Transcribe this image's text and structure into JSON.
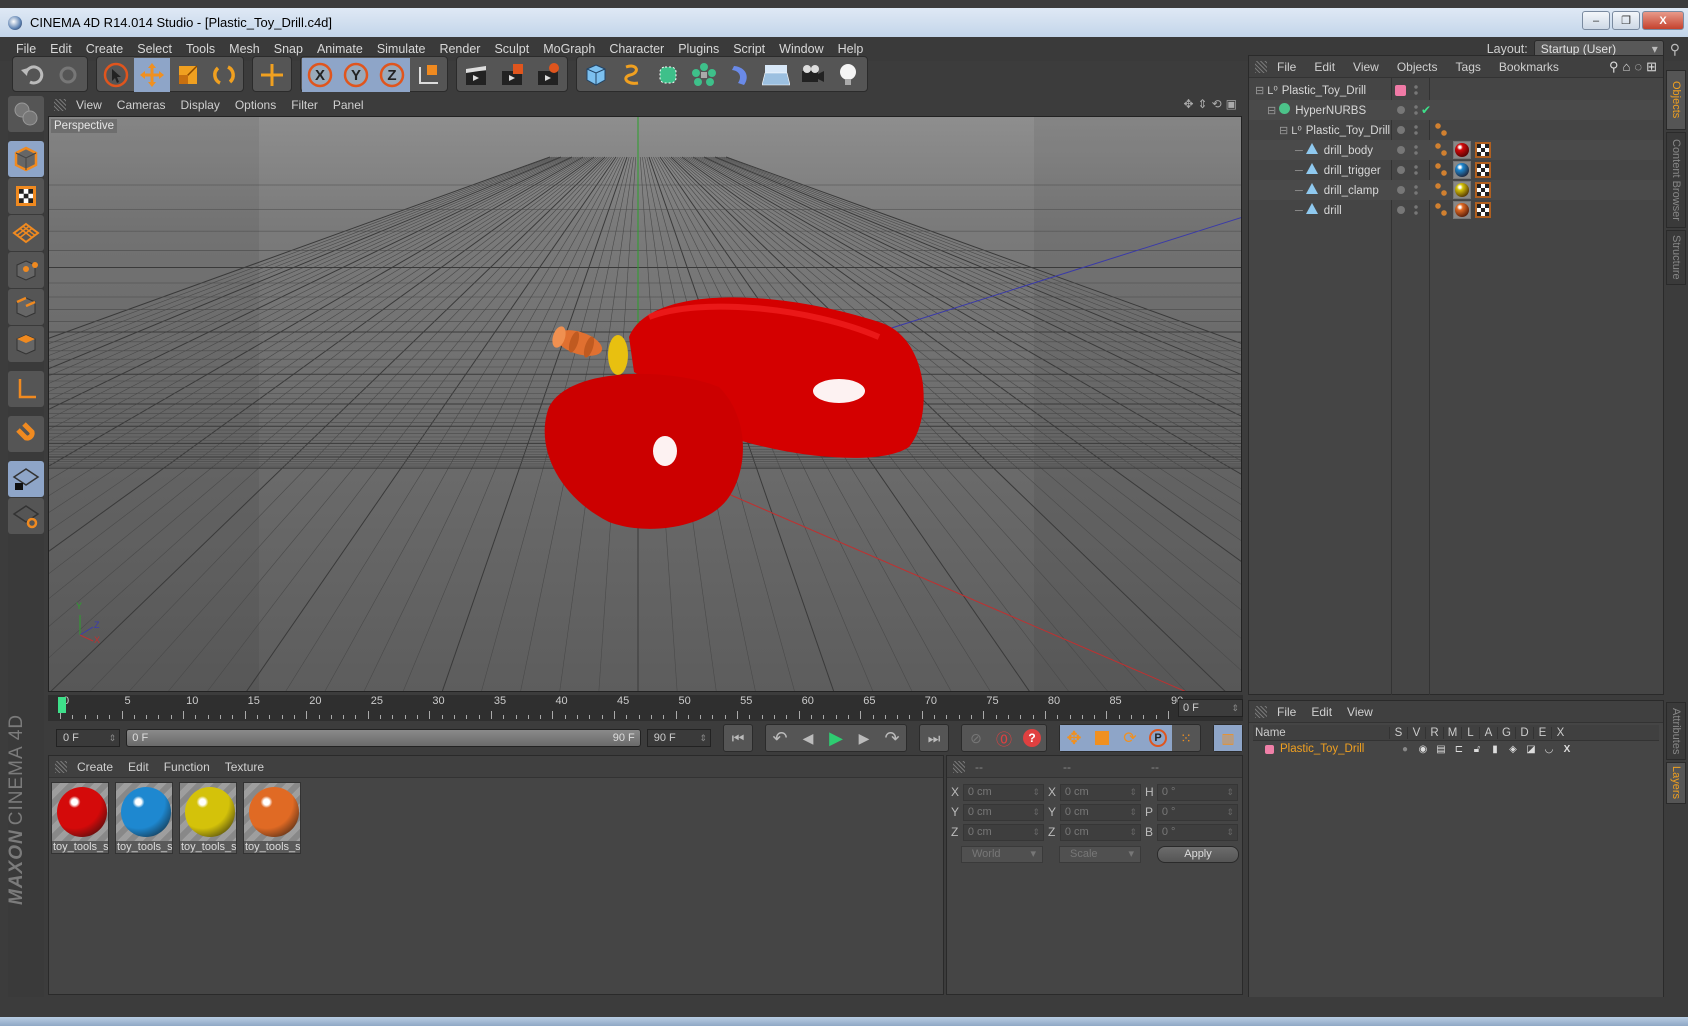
{
  "window": {
    "title": "CINEMA 4D R14.014 Studio - [Plastic_Toy_Drill.c4d]",
    "controls": {
      "minimize": "–",
      "restore": "❐",
      "close": "X"
    }
  },
  "menu": [
    "File",
    "Edit",
    "Create",
    "Select",
    "Tools",
    "Mesh",
    "Snap",
    "Animate",
    "Simulate",
    "Render",
    "Sculpt",
    "MoGraph",
    "Character",
    "Plugins",
    "Script",
    "Window",
    "Help"
  ],
  "layout": {
    "label": "Layout:",
    "value": "Startup (User)"
  },
  "toolbar": {
    "groups": [
      [
        "undo-icon",
        "redo-icon"
      ],
      [
        "live-selection-icon",
        "move-icon",
        "scale-icon",
        "rotate-icon"
      ],
      [
        "recent-tool-icon"
      ],
      [
        "x-axis-lock-icon",
        "y-axis-lock-icon",
        "z-axis-lock-icon",
        "world-coordinates-icon"
      ],
      [
        "render-view-icon",
        "render-picture-viewer-icon",
        "render-settings-icon"
      ],
      [
        "cube-object-icon",
        "spline-pen-icon",
        "subdivision-surface-icon",
        "cloner-icon",
        "deformer-icon",
        "floor-icon",
        "camera-icon",
        "light-icon"
      ]
    ]
  },
  "left_palette": [
    "camera-view-icon",
    "model-mode-icon",
    "texture-mode-icon",
    "workplane-mode-icon",
    "points-mode-icon",
    "edges-mode-icon",
    "polygons-mode-icon",
    "axis-mode-icon",
    "snap-magnet-icon",
    "workplane-lock-icon",
    "workplane-rotate-icon"
  ],
  "branding": {
    "maxon": "MAXON",
    "product": "CINEMA 4D"
  },
  "viewport": {
    "menu": [
      "View",
      "Cameras",
      "Display",
      "Options",
      "Filter",
      "Panel"
    ],
    "camera_label": "Perspective",
    "axis_labels": {
      "y": "Y",
      "z": "Z",
      "x": "X"
    }
  },
  "timeline": {
    "ticks": [
      "0",
      "5",
      "10",
      "15",
      "20",
      "25",
      "30",
      "35",
      "40",
      "45",
      "50",
      "55",
      "60",
      "65",
      "70",
      "75",
      "80",
      "85",
      "90"
    ],
    "current_frame": "0 F",
    "start_field": "0 F",
    "range_start": "0 F",
    "range_end": "90 F",
    "end_field": "90 F"
  },
  "playback": [
    "go-to-start-icon",
    "previous-key-icon",
    "previous-frame-icon",
    "play-icon",
    "next-frame-icon",
    "next-key-icon",
    "go-to-end-icon"
  ],
  "keying": [
    "record-keys-icon",
    "autokey-icon",
    "keyframe-selection-icon",
    "key-position-icon",
    "key-scale-icon",
    "key-rotation-icon",
    "key-param-icon",
    "key-pla-icon",
    "timeline-icon"
  ],
  "material_manager": {
    "menu": [
      "Create",
      "Edit",
      "Function",
      "Texture"
    ],
    "materials": [
      {
        "name": "toy_tools_s",
        "color": "#d40a0a"
      },
      {
        "name": "toy_tools_s",
        "color": "#1e88d0"
      },
      {
        "name": "toy_tools_s",
        "color": "#d4c20a"
      },
      {
        "name": "toy_tools_s",
        "color": "#e06a24"
      }
    ]
  },
  "coordinates": {
    "headers": [
      "--",
      "--",
      "--"
    ],
    "rows": [
      {
        "a1": "X",
        "v1": "0 cm",
        "a2": "X",
        "v2": "0 cm",
        "a3": "H",
        "v3": "0 °"
      },
      {
        "a1": "Y",
        "v1": "0 cm",
        "a2": "Y",
        "v2": "0 cm",
        "a3": "P",
        "v3": "0 °"
      },
      {
        "a1": "Z",
        "v1": "0 cm",
        "a2": "Z",
        "v2": "0 cm",
        "a3": "B",
        "v3": "0 °"
      }
    ],
    "mode": "World",
    "transform": "Scale",
    "apply": "Apply"
  },
  "object_manager": {
    "menu": [
      "File",
      "Edit",
      "View",
      "Objects",
      "Tags",
      "Bookmarks"
    ],
    "objects": [
      {
        "name": "Plastic_Toy_Drill",
        "type": "null",
        "level": 0,
        "layer_color": "#f07aa6"
      },
      {
        "name": "HyperNURBS",
        "type": "nurbs",
        "level": 1,
        "enabled": "✔"
      },
      {
        "name": "Plastic_Toy_Drill",
        "type": "null",
        "level": 2
      },
      {
        "name": "drill_body",
        "type": "polygon",
        "level": 3,
        "material": "#d40a0a"
      },
      {
        "name": "drill_trigger",
        "type": "polygon",
        "level": 3,
        "material": "#1e88d0"
      },
      {
        "name": "drill_clamp",
        "type": "polygon",
        "level": 3,
        "material": "#d4c20a"
      },
      {
        "name": "drill",
        "type": "polygon",
        "level": 3,
        "material": "#e06a24"
      }
    ]
  },
  "side_tabs_top": [
    {
      "label": "Objects",
      "active": true
    },
    {
      "label": "Content Browser",
      "active": false
    },
    {
      "label": "Structure",
      "active": false
    }
  ],
  "side_tabs_bottom": [
    {
      "label": "Attributes",
      "active": false
    },
    {
      "label": "Layers",
      "active": true
    }
  ],
  "layer_manager": {
    "menu": [
      "File",
      "Edit",
      "View"
    ],
    "columns": [
      "Name",
      "S",
      "V",
      "R",
      "M",
      "L",
      "A",
      "G",
      "D",
      "E",
      "X"
    ],
    "layers": [
      {
        "name": "Plastic_Toy_Drill",
        "color": "#f07aa6"
      }
    ]
  }
}
